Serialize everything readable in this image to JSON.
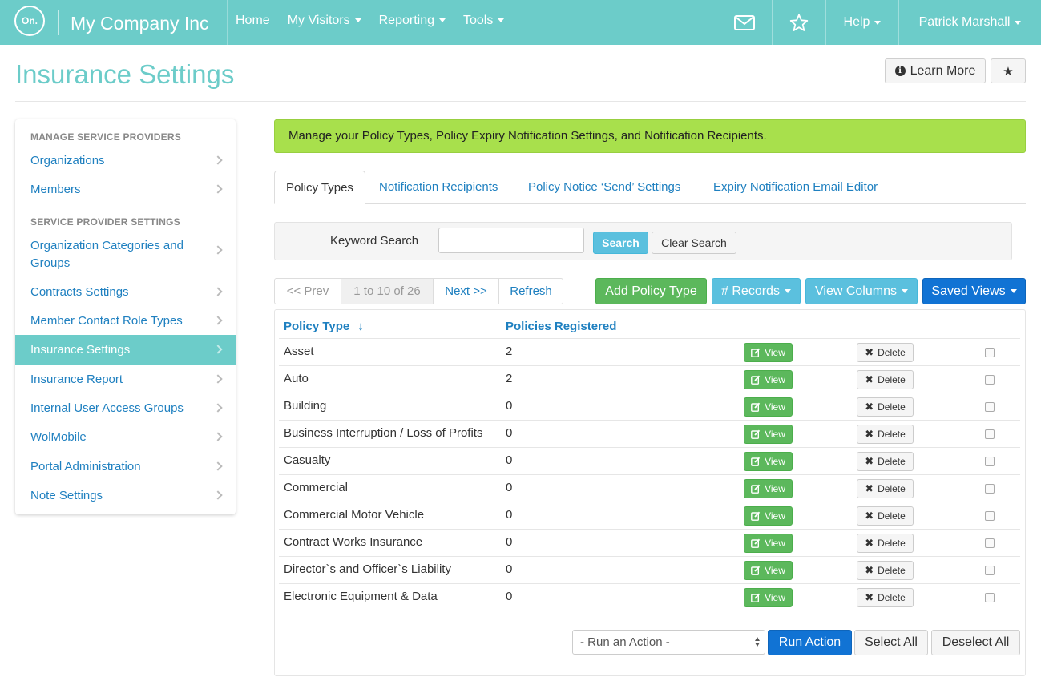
{
  "navbar": {
    "logo_text": "On.",
    "brand": "My Company Inc",
    "menu": [
      {
        "label": "Home",
        "has_caret": false
      },
      {
        "label": "My Visitors",
        "has_caret": true
      },
      {
        "label": "Reporting",
        "has_caret": true
      },
      {
        "label": "Tools",
        "has_caret": true
      }
    ],
    "right": {
      "mail_icon": "envelope-icon",
      "favorites_icon": "star-outline-icon",
      "help_label": "Help",
      "user_name": "Patrick Marshall"
    },
    "bg_color": "#6cccc9"
  },
  "page": {
    "title": "Insurance Settings",
    "learn_more_label": "Learn More",
    "learn_more_icon": "info-circle-icon",
    "star_icon": "star-icon",
    "star_glyph": "★"
  },
  "sidebar": {
    "heading_1": "MANAGE SERVICE PROVIDERS",
    "heading_2": "SERVICE PROVIDER SETTINGS",
    "items": [
      {
        "label": "Organizations",
        "active": false
      },
      {
        "label": "Members",
        "active": false
      },
      {
        "label": "Organization Categories and Groups",
        "active": false
      },
      {
        "label": "Contracts Settings",
        "active": false
      },
      {
        "label": "Member Contact Role Types",
        "active": false
      },
      {
        "label": "Insurance Settings",
        "active": true
      },
      {
        "label": "Insurance Report",
        "active": false
      },
      {
        "label": "Internal User Access Groups",
        "active": false
      },
      {
        "label": "WolMobile",
        "active": false
      },
      {
        "label": "Portal Administration",
        "active": false
      },
      {
        "label": "Note Settings",
        "active": false
      }
    ]
  },
  "alert": {
    "text": "Manage your Policy Types, Policy Expiry Notification Settings, and Notification Recipients.",
    "color": "#a8e04c"
  },
  "tabs": [
    {
      "label": "Policy Types",
      "active": true
    },
    {
      "label": "Notification Recipients",
      "active": false
    },
    {
      "label": "Policy Notice ‘Send’ Settings",
      "active": false
    },
    {
      "label": "Expiry Notification Email Editor",
      "active": false
    }
  ],
  "search": {
    "label": "Keyword Search",
    "value": "",
    "search_button": "Search",
    "clear_button": "Clear Search"
  },
  "pager": {
    "prev": "<< Prev",
    "count": "1 to 10 of 26",
    "next": "Next >>",
    "refresh": "Refresh"
  },
  "toolbar": {
    "add": "Add Policy Type",
    "records": "# Records",
    "view_columns": "View Columns",
    "saved_views": "Saved Views"
  },
  "table": {
    "columns": [
      "Policy Type",
      "Policies Registered"
    ],
    "sort_arrow": "↓",
    "view_label": "View",
    "delete_label": "Delete",
    "delete_glyph": "✖",
    "rows": [
      {
        "name": "Asset",
        "count": "2"
      },
      {
        "name": "Auto",
        "count": "2"
      },
      {
        "name": "Building",
        "count": "0"
      },
      {
        "name": "Business Interruption / Loss of Profits",
        "count": "0"
      },
      {
        "name": "Casualty",
        "count": "0"
      },
      {
        "name": "Commercial",
        "count": "0"
      },
      {
        "name": "Commercial Motor Vehicle",
        "count": "0"
      },
      {
        "name": "Contract Works Insurance",
        "count": "0"
      },
      {
        "name": "Director`s and Officer`s Liability",
        "count": "0"
      },
      {
        "name": "Electronic Equipment & Data",
        "count": "0"
      }
    ]
  },
  "actions": {
    "select_value": "- Run an Action -",
    "run": "Run Action",
    "select_all": "Select All",
    "deselect_all": "Deselect All"
  }
}
